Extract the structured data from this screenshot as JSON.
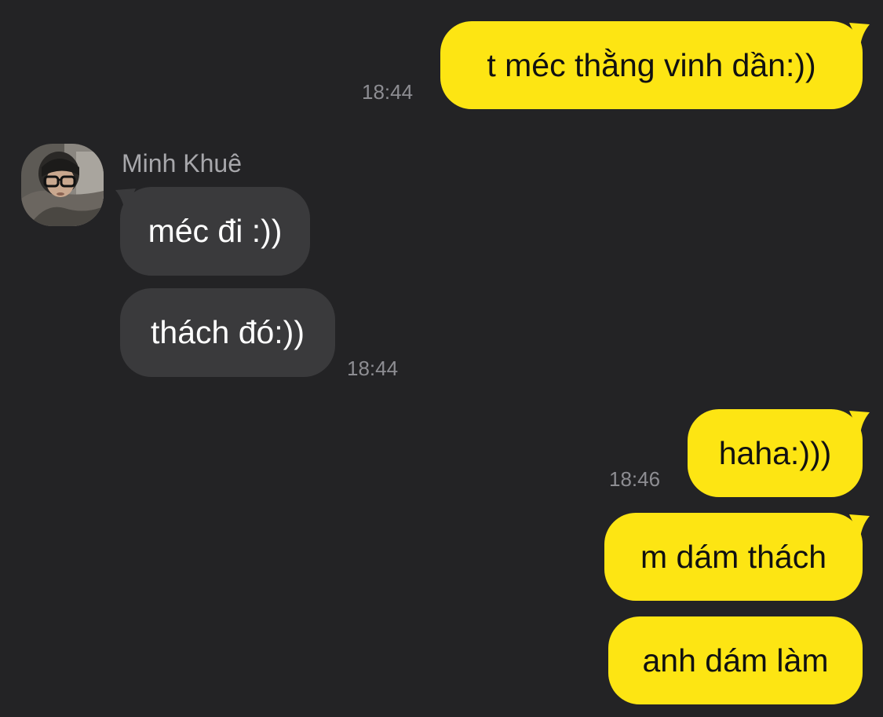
{
  "chat": {
    "contact_name": "Minh Khuê",
    "messages": [
      {
        "side": "out",
        "text": "t méc thằng vinh dần:))",
        "time": "18:44"
      },
      {
        "side": "in",
        "text": "méc đi :))"
      },
      {
        "side": "in",
        "text": "thách đó:))",
        "time": "18:44"
      },
      {
        "side": "out",
        "text": "haha:)))",
        "time": "18:46"
      },
      {
        "side": "out",
        "text": "m dám thách"
      },
      {
        "side": "out",
        "text": "anh dám làm"
      }
    ]
  },
  "colors": {
    "background": "#232325",
    "outgoing_bubble": "#fde513",
    "incoming_bubble": "#3a3a3c",
    "timestamp": "#8d8d92",
    "sender_name": "#a7a7ab"
  },
  "icons": {
    "avatar": "contact-avatar-photo"
  }
}
